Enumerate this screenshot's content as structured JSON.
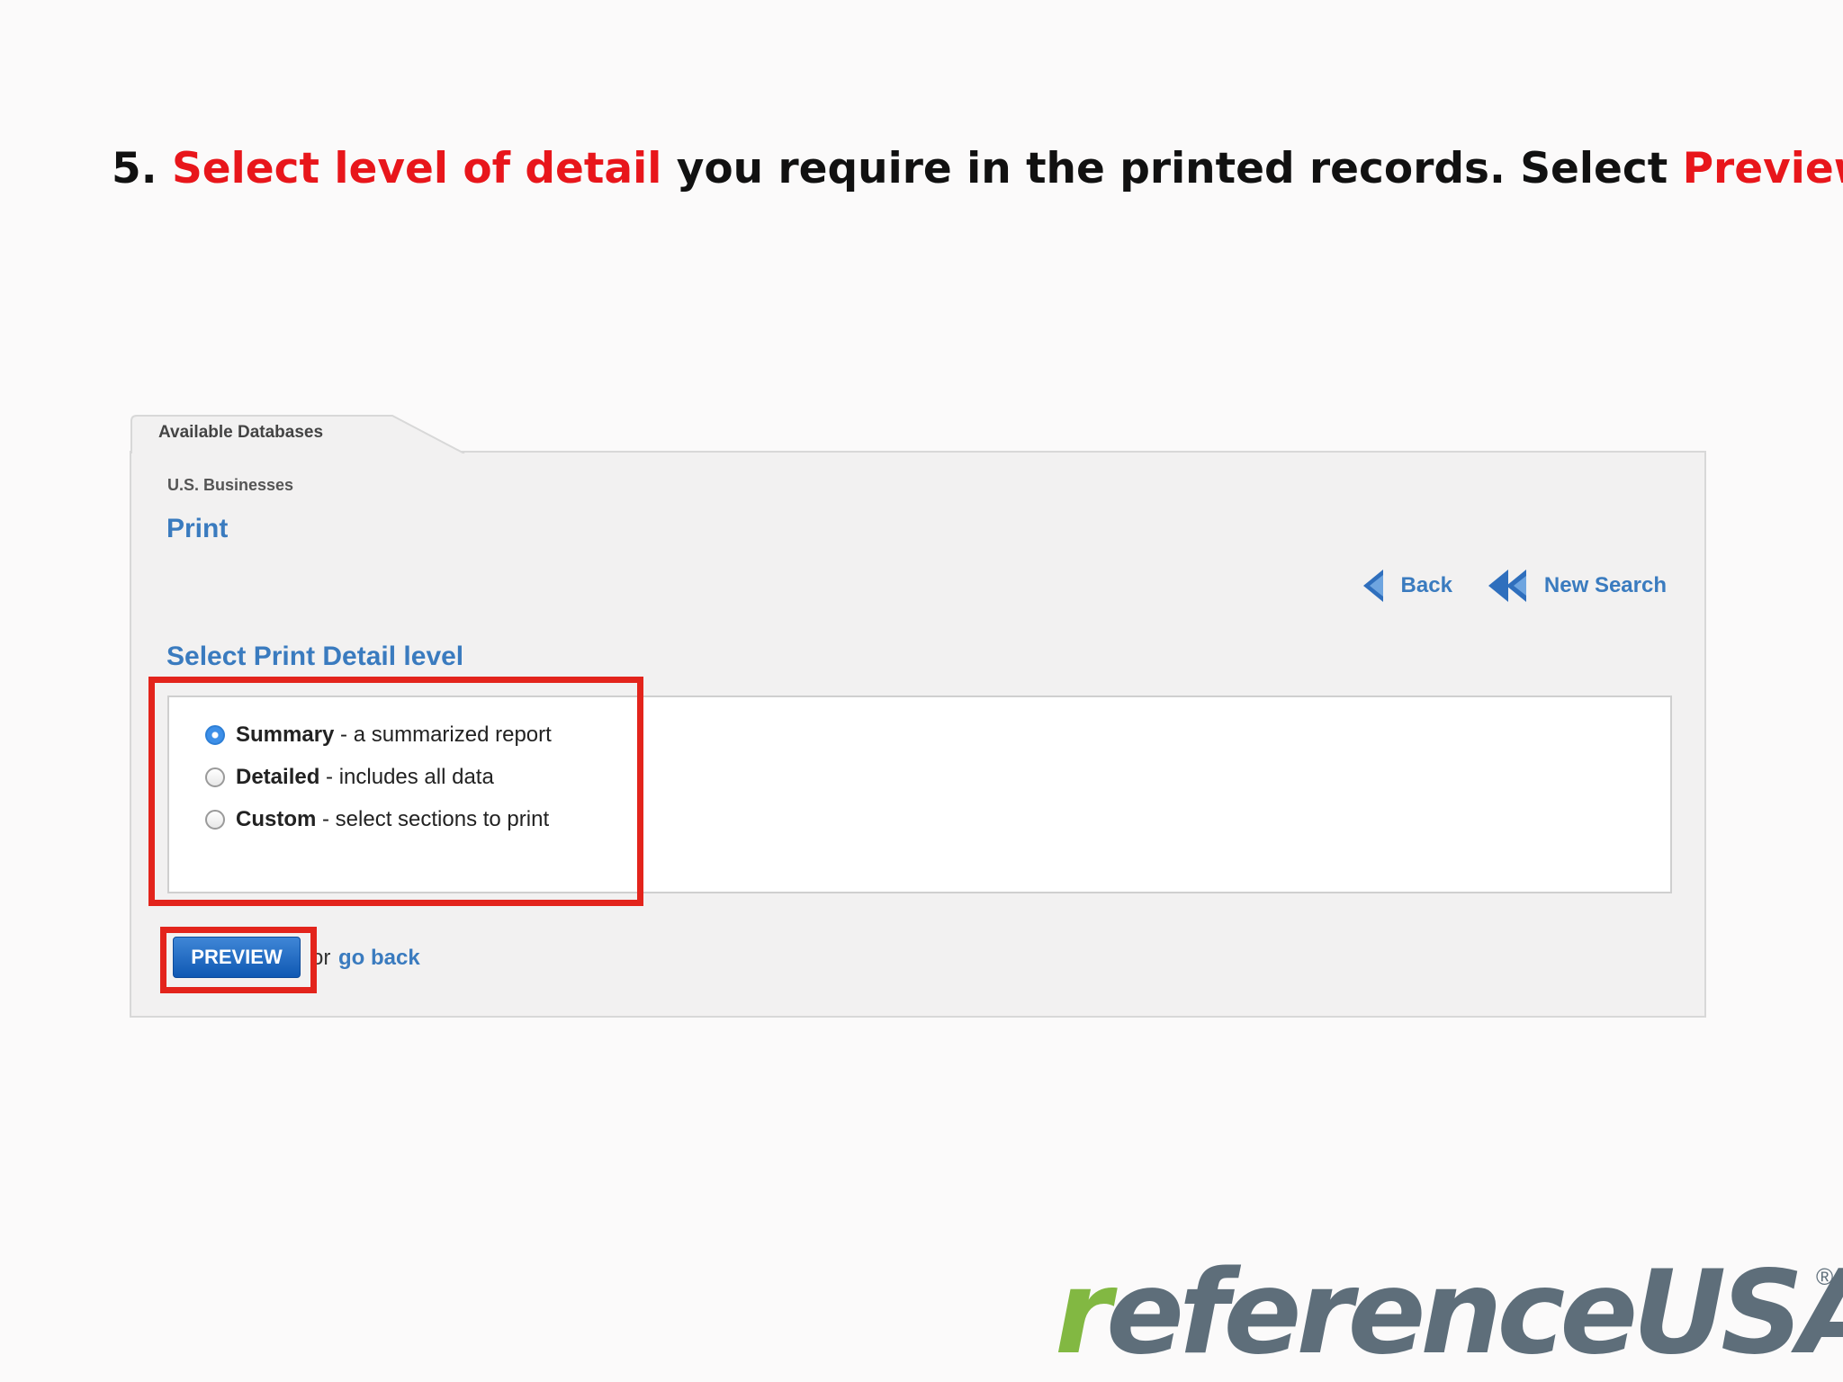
{
  "slide": {
    "step_number": "5.",
    "title_part1_red": "Select level of detail",
    "title_part2": " you require in the printed records.  Select ",
    "title_part3_red": "Preview",
    "title_end": "."
  },
  "app": {
    "tab_label": "Available Databases",
    "database_name": "U.S. Businesses",
    "page_heading": "Print",
    "nav": {
      "back_label": "Back",
      "new_search_label": "New Search"
    },
    "section_title": "Select Print Detail level",
    "options": [
      {
        "name": "Summary",
        "description": " - a summarized report",
        "checked": true
      },
      {
        "name": "Detailed",
        "description": " - includes all data",
        "checked": false
      },
      {
        "name": "Custom",
        "description": " - select sections to print",
        "checked": false
      }
    ],
    "preview_label": "PREVIEW",
    "or_text": "or",
    "go_back_label": "go back"
  },
  "colors": {
    "highlight": "#e3241c",
    "link_blue": "#3a7bbf",
    "button_blue": "#1a63bd",
    "logo_green": "#82b842",
    "logo_gray": "#5e6e7a"
  },
  "logo": {
    "first_letter": "r",
    "rest": "eferenceUSA",
    "registered": "®"
  }
}
